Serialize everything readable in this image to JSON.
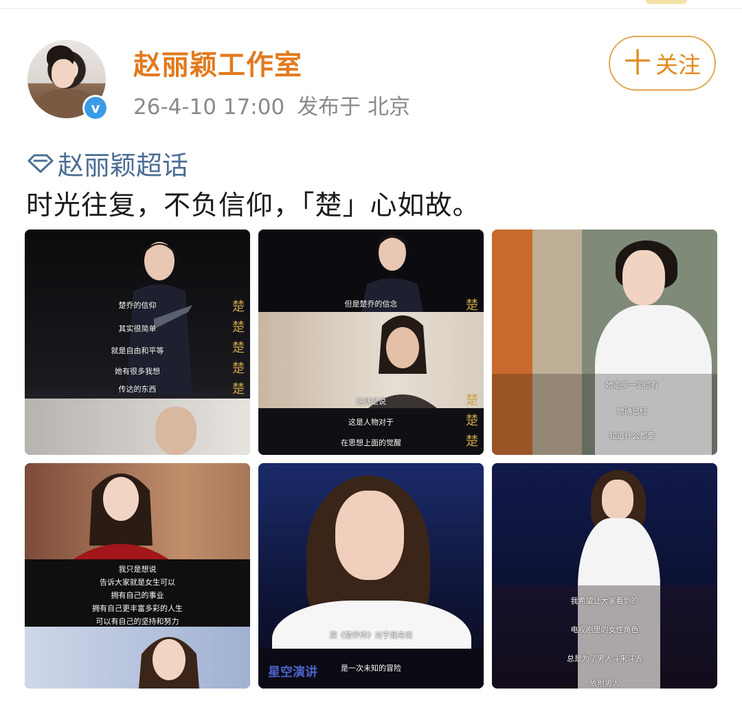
{
  "post": {
    "author": "赵丽颖工作室",
    "date": "26-4-10 17:00",
    "location": "发布于 北京",
    "follow_label": "关注",
    "follow_plus": "十",
    "verified_mark": "v",
    "topic": "赵丽颖超话",
    "text": "时光往复，不负信仰，「楚」心如故。"
  },
  "images": [
    {
      "captions": [
        "楚乔的信仰",
        "其实很简单",
        "就是自由和平等",
        "她有很多我想",
        "传达的东西"
      ],
      "logo": "楚"
    },
    {
      "captions": [
        "但是楚乔的信念",
        "这就是说",
        "这是人物对于",
        "在思想上面的觉醒"
      ],
      "logo": "楚"
    },
    {
      "captions": [
        "她走多一定信有",
        "她确已经",
        "知道什么都要"
      ]
    },
    {
      "captions": [
        "我只是想说",
        "告诉大家就是女生可以",
        "拥有自己的事业",
        "拥有自己更丰富多彩的人生",
        "可以有自己的坚持和努力"
      ]
    },
    {
      "captions": [
        "演《楚乔传》对于我来说",
        "是一次未知的冒险"
      ],
      "banner": "星空演讲"
    },
    {
      "captions": [
        "我希望让大家看到的",
        "电视剧里的女性角色",
        "总是为了男人斗来斗去",
        "依附男人"
      ]
    }
  ],
  "colors": {
    "author": "#e27a1e",
    "topic": "#4a6d94",
    "verified": "#3a9be8",
    "follow_border": "#e2a64f"
  }
}
